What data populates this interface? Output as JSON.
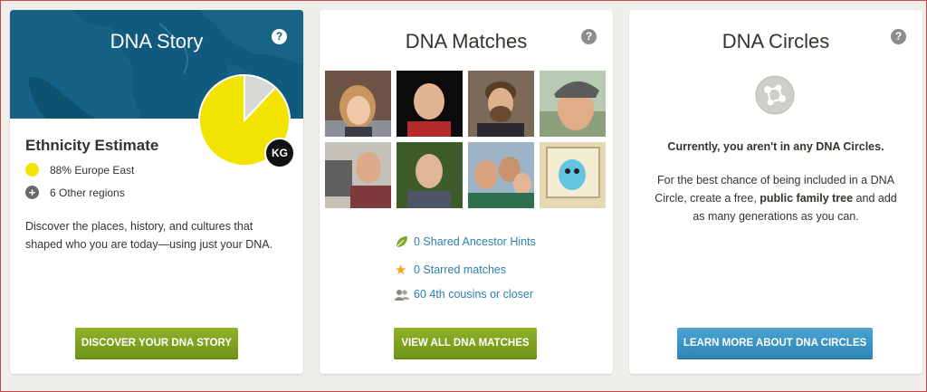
{
  "story": {
    "title": "DNA Story",
    "help": "?",
    "initials": "KG",
    "ethnicity_title": "Ethnicity Estimate",
    "primary_region": "88% Europe East",
    "primary_percent": 88,
    "other_regions": "6 Other regions",
    "description": "Discover the places, history, and cultures that shaped who you are today—using just your DNA.",
    "button": "DISCOVER YOUR DNA STORY",
    "colors": {
      "banner": "#0f5a7d",
      "pie_main": "#f2e400",
      "pie_rest": "#d8d8d4"
    }
  },
  "matches": {
    "title": "DNA Matches",
    "help": "?",
    "photos": [
      {
        "name": "match-photo-woman-blond"
      },
      {
        "name": "match-photo-man-bald"
      },
      {
        "name": "match-photo-man-bearded"
      },
      {
        "name": "match-photo-woman-cap"
      },
      {
        "name": "match-photo-man-camera"
      },
      {
        "name": "match-photo-man-outdoors"
      },
      {
        "name": "match-photo-group-selfie"
      },
      {
        "name": "match-photo-cartoon"
      }
    ],
    "hints": "0 Shared Ancestor Hints",
    "starred": "0 Starred matches",
    "cousins": "60 4th cousins or closer",
    "button": "VIEW ALL DNA MATCHES"
  },
  "circles": {
    "title": "DNA Circles",
    "help": "?",
    "status": "Currently, you aren't in any DNA Circles.",
    "text_before": "For the best chance of being included in a DNA Circle, create a free, ",
    "text_bold": "public family tree",
    "text_after": " and add as many generations as you can.",
    "button": "LEARN MORE ABOUT DNA CIRCLES"
  }
}
